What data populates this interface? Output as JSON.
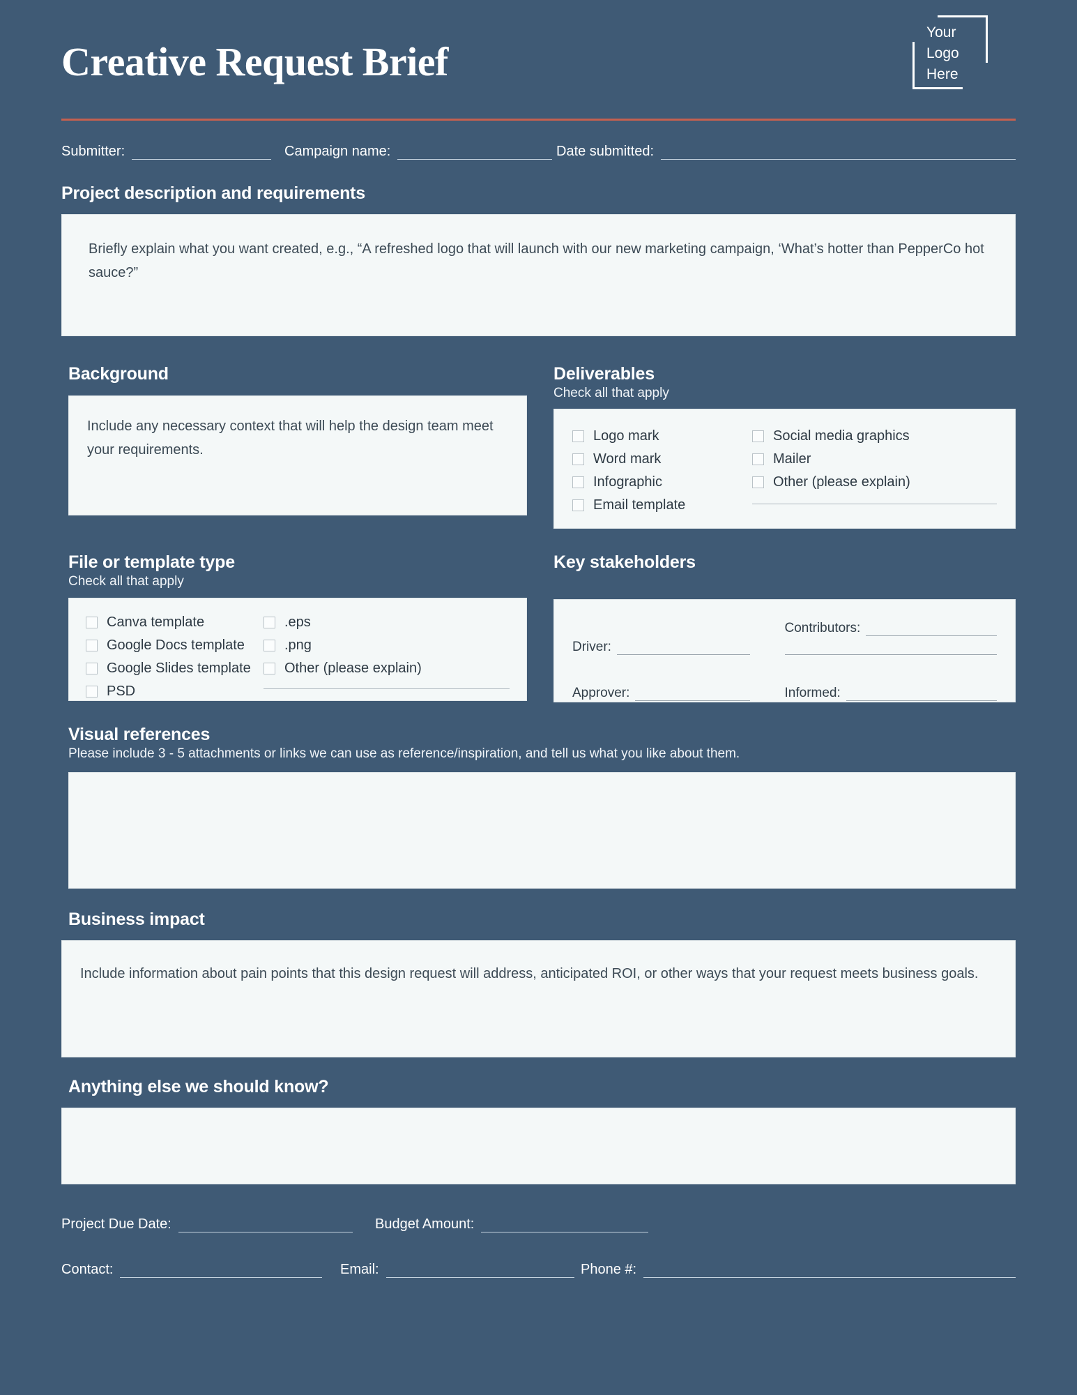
{
  "header": {
    "title": "Creative Request Brief",
    "logo_lines": [
      "Your",
      "Logo",
      "Here"
    ],
    "accent_color": "#C4604F",
    "background_color": "#3F5A75",
    "card_color": "#F4F8F8"
  },
  "top_fields": [
    {
      "label": "Submitter:"
    },
    {
      "label": "Campaign name:"
    },
    {
      "label": "Date submitted:"
    }
  ],
  "project_description": {
    "heading": "Project description and requirements",
    "placeholder": "Briefly explain what you want created, e.g., “A refreshed logo that will launch with our new marketing campaign, ‘What’s hotter than PepperCo hot sauce?”"
  },
  "background": {
    "heading": "Background",
    "placeholder": "Include any necessary context that will help the design team meet your requirements."
  },
  "deliverables": {
    "heading": "Deliverables",
    "subheading": "Check all that apply",
    "column_1": [
      "Logo mark",
      "Word mark",
      "Infographic",
      "Email template"
    ],
    "column_2": [
      "Social media graphics",
      "Mailer",
      "Other (please explain)"
    ]
  },
  "file_type": {
    "heading": "File or template type",
    "subheading": "Check all that apply",
    "column_1": [
      "Canva template",
      "Google Docs template",
      "Google Slides template",
      "PSD"
    ],
    "column_2": [
      ".eps",
      ".png",
      "Other (please explain)"
    ]
  },
  "key_stakeholders": {
    "heading": "Key stakeholders",
    "fields": [
      "Driver:",
      "Contributors:",
      "Approver:",
      "Informed:"
    ]
  },
  "visual_references": {
    "heading": "Visual references",
    "subheading": "Please include 3 - 5 attachments or links we can use as reference/inspiration, and tell us what you like about them.",
    "value": ""
  },
  "business_impact": {
    "heading": "Business impact",
    "placeholder": "Include information about pain points that this design request will address, anticipated ROI, or other ways that your request meets business goals."
  },
  "anything_else": {
    "heading": "Anything else we should know?",
    "value": ""
  },
  "footer": {
    "row_1": [
      {
        "label": "Project Due Date:"
      },
      {
        "label": "Budget Amount:"
      }
    ],
    "row_2": [
      {
        "label": "Contact:"
      },
      {
        "label": "Email:"
      },
      {
        "label": "Phone #:"
      }
    ]
  }
}
